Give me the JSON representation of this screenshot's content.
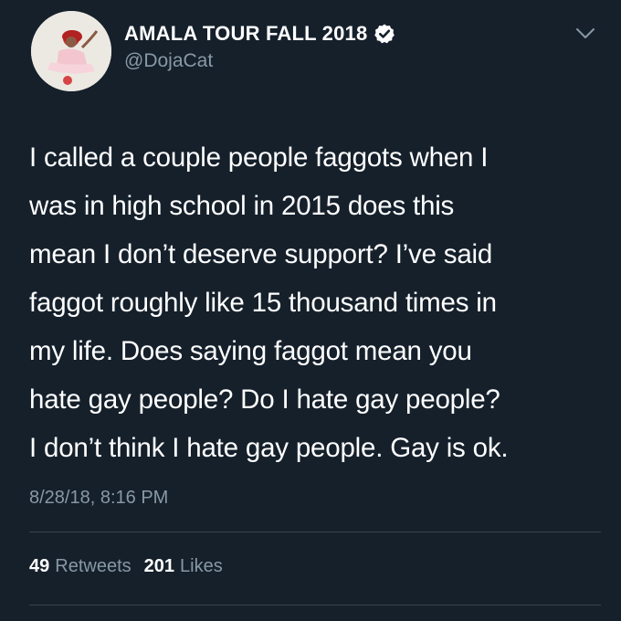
{
  "author": {
    "display_name": "AMALA TOUR FALL 2018",
    "handle": "@DojaCat",
    "verified": true
  },
  "tweet": {
    "lines": [
      "I called a couple people faggots when I",
      "was in high school in 2015 does this",
      "mean I don’t deserve support? I’ve said",
      "faggot roughly like 15 thousand times in",
      "my life. Does saying faggot mean you",
      "hate gay people? Do I hate gay people?",
      "I don’t think I hate gay people. Gay is ok."
    ],
    "timestamp": "8/28/18, 8:16 PM"
  },
  "stats": {
    "retweets_count": "49",
    "retweets_label": "Retweets",
    "likes_count": "201",
    "likes_label": "Likes"
  },
  "colors": {
    "background": "#15202b",
    "text_primary": "#ffffff",
    "text_secondary": "#8899a6",
    "divider": "#38444d"
  },
  "icons": {
    "verified": "verified-badge-icon",
    "caret": "chevron-down-icon"
  }
}
